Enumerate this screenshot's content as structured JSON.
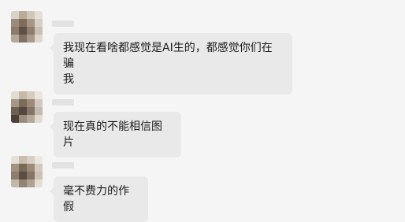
{
  "chat": {
    "messages": [
      {
        "sender_name": "",
        "text": "我现在看啥都感觉是AI生的，都感觉你们在骗\n我"
      },
      {
        "sender_name": "",
        "text": "现在真的不能相信图片"
      },
      {
        "sender_name": "",
        "text": "毫不费力的作假"
      }
    ]
  },
  "colors": {
    "background": "#f5f5f5",
    "bubble": "#e9e9e9",
    "text": "#1c1c1c"
  }
}
